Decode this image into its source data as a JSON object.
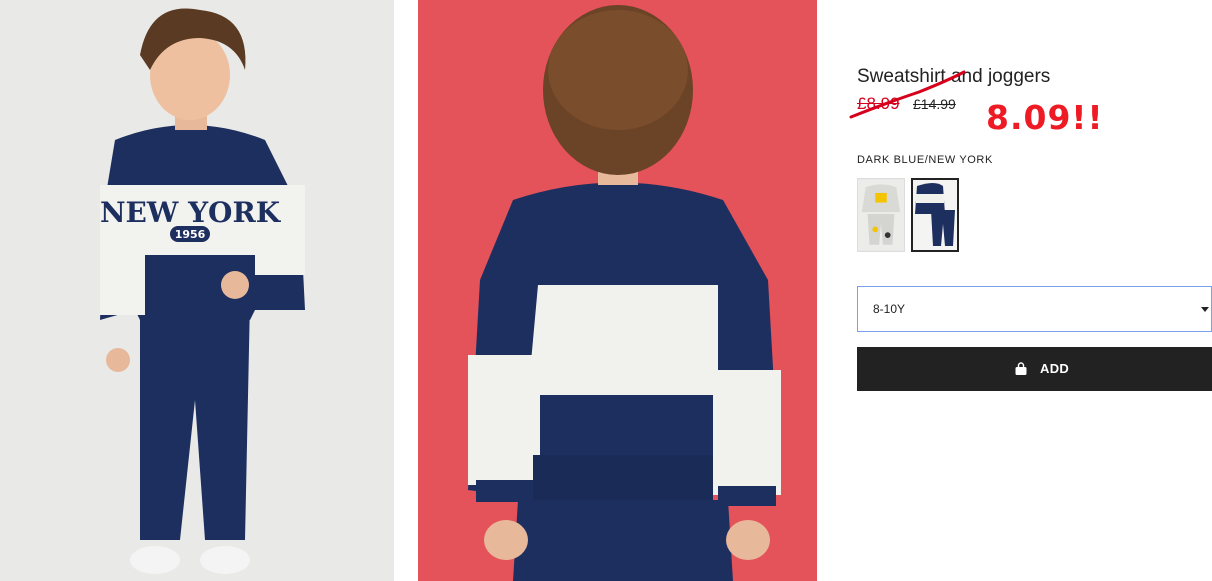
{
  "product": {
    "title": "Sweatshirt and joggers",
    "sale_price": "£8.99",
    "original_price": "£14.99",
    "annotation": "8.09!!",
    "color_name": "DARK BLUE/NEW YORK",
    "swatches": [
      "light-grey-print-set",
      "dark-blue-new-york-set"
    ]
  },
  "front_print": {
    "line1": "NEW YORK",
    "line2": "1956"
  },
  "size_select": {
    "selected": "8-10Y"
  },
  "add_button": {
    "label": "ADD",
    "icon": "bag-icon"
  },
  "colors": {
    "sale_red": "#d6001c",
    "annotation_red": "#ee1b24",
    "button_black": "#222222",
    "navy": "#1d2f5f",
    "backdrop_red": "#e4525a",
    "select_border": "#7aa2ea"
  }
}
